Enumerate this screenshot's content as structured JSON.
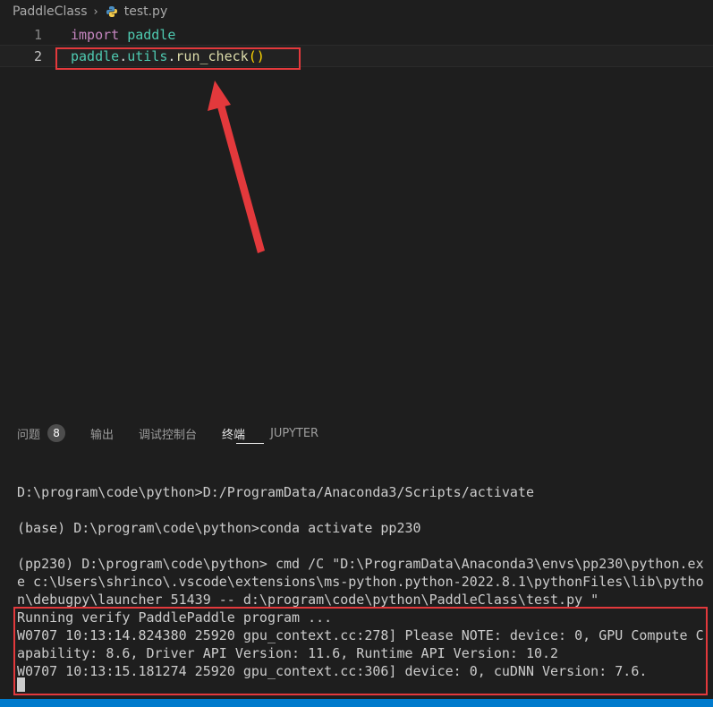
{
  "breadcrumb": {
    "folder": "PaddleClass",
    "separator": "›",
    "file": "test.py",
    "file_icon": "python-icon"
  },
  "editor": {
    "lines": [
      {
        "number": "1",
        "tokens": [
          "import",
          " ",
          "paddle"
        ]
      },
      {
        "number": "2",
        "tokens": [
          "paddle",
          ".",
          "utils",
          ".",
          "run_check",
          "(",
          ")"
        ]
      }
    ]
  },
  "annotation": {
    "color": "#e3393c"
  },
  "panel": {
    "tabs": [
      {
        "label": "问题",
        "badge": "8"
      },
      {
        "label": "输出"
      },
      {
        "label": "调试控制台"
      },
      {
        "label": "终端",
        "active": true
      },
      {
        "label": "JUPYTER"
      }
    ]
  },
  "terminal": {
    "lines": [
      "D:\\program\\code\\python>D:/ProgramData/Anaconda3/Scripts/activate",
      "(base) D:\\program\\code\\python>conda activate pp230",
      "(pp230) D:\\program\\code\\python> cmd /C \"D:\\ProgramData\\Anaconda3\\envs\\pp230\\python.ex",
      "e c:\\Users\\shrinco\\.vscode\\extensions\\ms-python.python-2022.8.1\\pythonFiles\\lib\\pytho",
      "n\\debugpy\\launcher 51439 -- d:\\program\\code\\python\\PaddleClass\\test.py \"",
      "Running verify PaddlePaddle program ...",
      "W0707 10:13:14.824380 25920 gpu_context.cc:278] Please NOTE: device: 0, GPU Compute C",
      "apability: 8.6, Driver API Version: 11.6, Runtime API Version: 10.2",
      "W0707 10:13:15.181274 25920 gpu_context.cc:306] device: 0, cuDNN Version: 7.6."
    ]
  },
  "colors": {
    "background": "#1e1e1e",
    "statusbar": "#007acc",
    "highlight_box": "#e3393c"
  }
}
